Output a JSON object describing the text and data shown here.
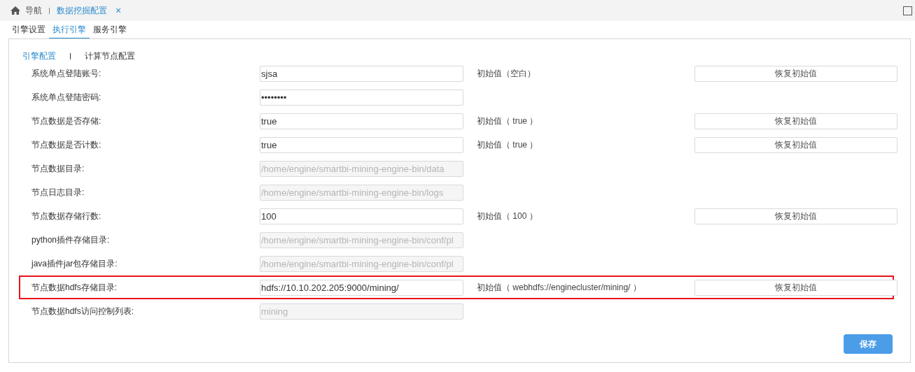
{
  "top_tabs": [
    {
      "label": "导航",
      "kind": "home",
      "selected": false
    },
    {
      "label": "数据挖掘配置",
      "kind": "page",
      "selected": true,
      "close": "×"
    }
  ],
  "engine_tabs": [
    {
      "label": "引擎设置",
      "selected": false
    },
    {
      "label": "执行引擎",
      "selected": true
    },
    {
      "label": "服务引擎",
      "selected": false
    }
  ],
  "sub_tabs": [
    {
      "label": "引擎配置",
      "selected": true
    },
    {
      "label": "计算节点配置",
      "selected": false
    }
  ],
  "rows": [
    {
      "label": "系统单点登陆账号:",
      "kind": "text",
      "value": "sjsa",
      "initial": "初始值（空白）",
      "restore": "恢复初始值",
      "highlighted": false
    },
    {
      "label": "系统单点登陆密码:",
      "kind": "password",
      "value": "••••••••",
      "highlighted": false
    },
    {
      "label": "节点数据是否存储:",
      "kind": "text",
      "value": "true",
      "initial": "初始值（ true ）",
      "restore": "恢复初始值",
      "highlighted": false
    },
    {
      "label": "节点数据是否计数:",
      "kind": "text",
      "value": "true",
      "initial": "初始值（ true ）",
      "restore": "恢复初始值",
      "highlighted": false
    },
    {
      "label": "节点数据目录:",
      "kind": "readonly",
      "value": "/home/engine/smartbi-mining-engine-bin/data",
      "highlighted": false
    },
    {
      "label": "节点日志目录:",
      "kind": "readonly",
      "value": "/home/engine/smartbi-mining-engine-bin/logs",
      "highlighted": false
    },
    {
      "label": "节点数据存储行数:",
      "kind": "text",
      "value": "100",
      "initial": "初始值（ 100 ）",
      "restore": "恢复初始值",
      "highlighted": false
    },
    {
      "label": "python插件存储目录:",
      "kind": "readonly",
      "value": "/home/engine/smartbi-mining-engine-bin/conf/pl",
      "highlighted": false
    },
    {
      "label": "java插件jar包存储目录:",
      "kind": "readonly",
      "value": "/home/engine/smartbi-mining-engine-bin/conf/pl",
      "highlighted": false
    },
    {
      "label": "节点数据hdfs存储目录:",
      "kind": "text",
      "value": "hdfs://10.10.202.205:9000/mining/",
      "initial": "初始值（ webhdfs://enginecluster/mining/ ）",
      "restore": "恢复初始值",
      "highlighted": true
    },
    {
      "label": "节点数据hdfs访问控制列表:",
      "kind": "readonly",
      "value": "mining",
      "highlighted": false
    }
  ],
  "save_button": "保存"
}
